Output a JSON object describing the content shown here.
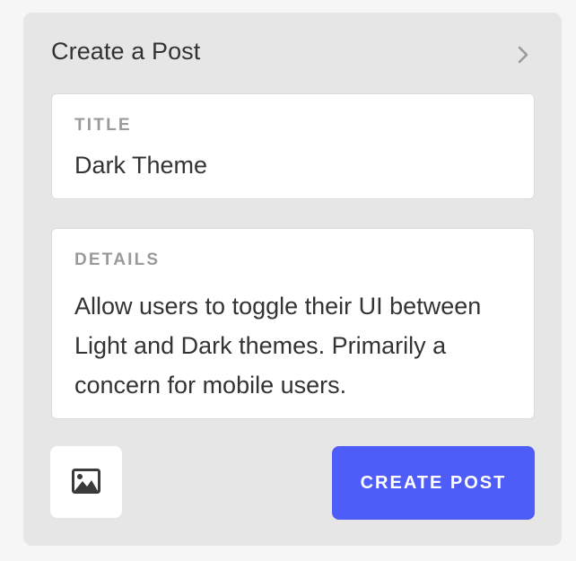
{
  "panel": {
    "title": "Create a Post",
    "expand_icon": "chevron-right-icon"
  },
  "title_field": {
    "label": "TITLE",
    "value": "Dark Theme"
  },
  "details_field": {
    "label": "DETAILS",
    "value": "Allow users to toggle their UI between Light and Dark themes. Primarily a concern for mobile users."
  },
  "actions": {
    "image_icon": "image-icon",
    "submit_label": "CREATE POST"
  },
  "colors": {
    "accent": "#4e5cf8",
    "panel_bg": "#e6e6e6",
    "text": "#333333",
    "label": "#9a9a9a"
  }
}
